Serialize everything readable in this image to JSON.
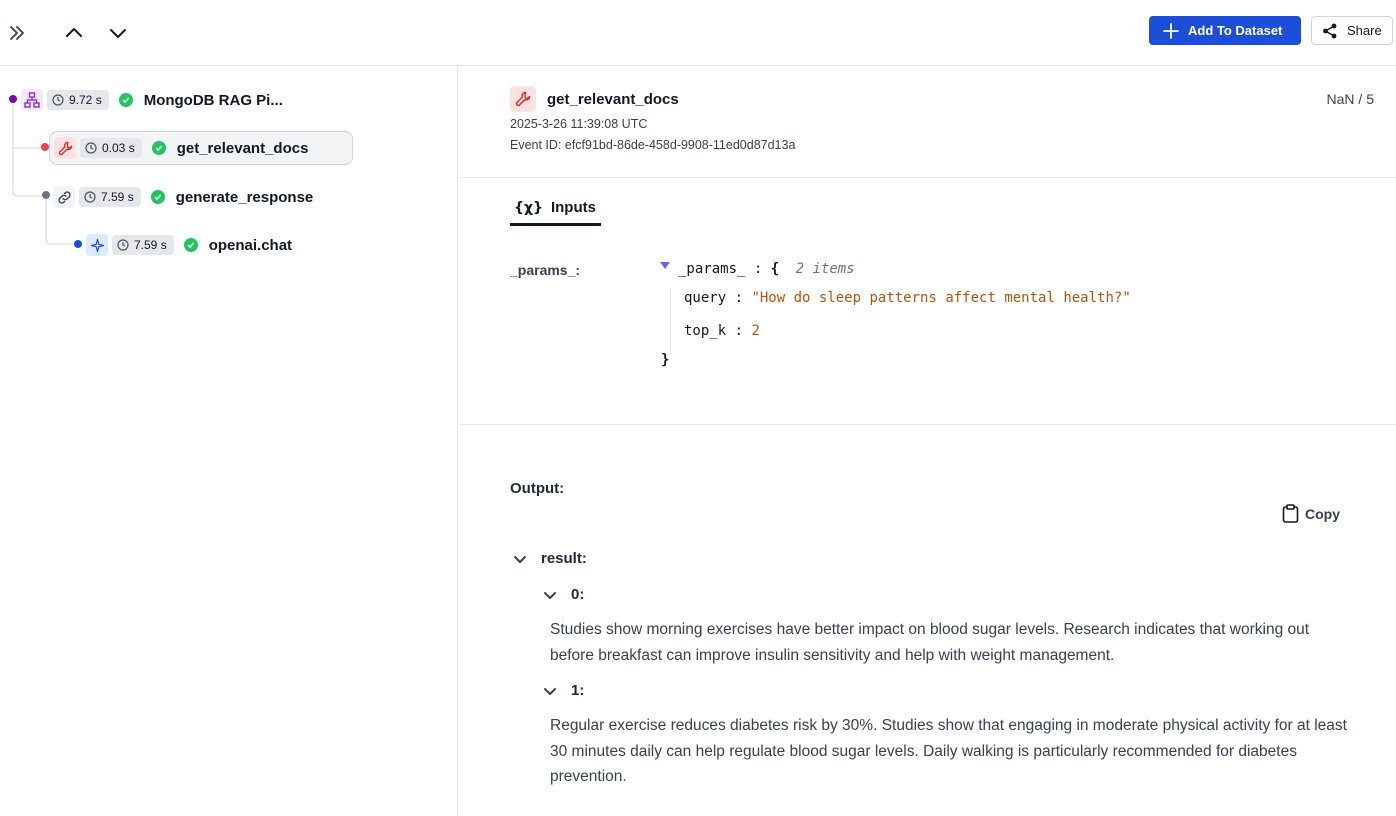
{
  "toolbar": {
    "add_to_dataset": "Add To Dataset",
    "share": "Share"
  },
  "trace": [
    {
      "name": "MongoDB RAG Pi...",
      "duration": "9.72 s",
      "type": "chain-icon",
      "status": "success",
      "dot_color": "#7c0a9c"
    },
    {
      "name": "get_relevant_docs",
      "duration": "0.03 s",
      "type": "wrench-icon",
      "status": "success",
      "dot_color": "#ef4444",
      "selected": true
    },
    {
      "name": "generate_response",
      "duration": "7.59 s",
      "type": "link-icon",
      "status": "success",
      "dot_color": "#6b7280"
    },
    {
      "name": "openai.chat",
      "duration": "7.59 s",
      "type": "sparkle-icon",
      "status": "success",
      "dot_color": "#1d4ed8"
    }
  ],
  "detail": {
    "title": "get_relevant_docs",
    "timestamp": "2025-3-26 11:39:08 UTC",
    "event_id": "Event ID: efcf91bd-86de-458d-9908-11ed0d87d13a",
    "counter": "NaN / 5",
    "tab_icon": "{χ}",
    "tab_label": "Inputs",
    "param_label": "_params_:",
    "json": {
      "root_key": "_params_",
      "colon": " : ",
      "open": "{",
      "close": "}",
      "count": "2 items",
      "query_key": "query",
      "query_value": "\"How do sleep patterns affect mental health?\"",
      "topk_key": "top_k",
      "topk_value": "2"
    },
    "output_label": "Output:",
    "copy_label": "Copy",
    "result_key": "result:",
    "items": [
      {
        "key": "0:",
        "text": "Studies show morning exercises have better impact on blood sugar levels. Research indicates that working out before breakfast can improve insulin sensitivity and help with weight management."
      },
      {
        "key": "1:",
        "text": "Regular exercise reduces diabetes risk by 30%. Studies show that engaging in moderate physical activity for at least 30 minutes daily can help regulate blood sugar levels. Daily walking is particularly recommended for diabetes prevention."
      }
    ]
  },
  "colors": {
    "primary": "#1d4ed8",
    "success": "#22c55e",
    "string": "#b45309"
  }
}
